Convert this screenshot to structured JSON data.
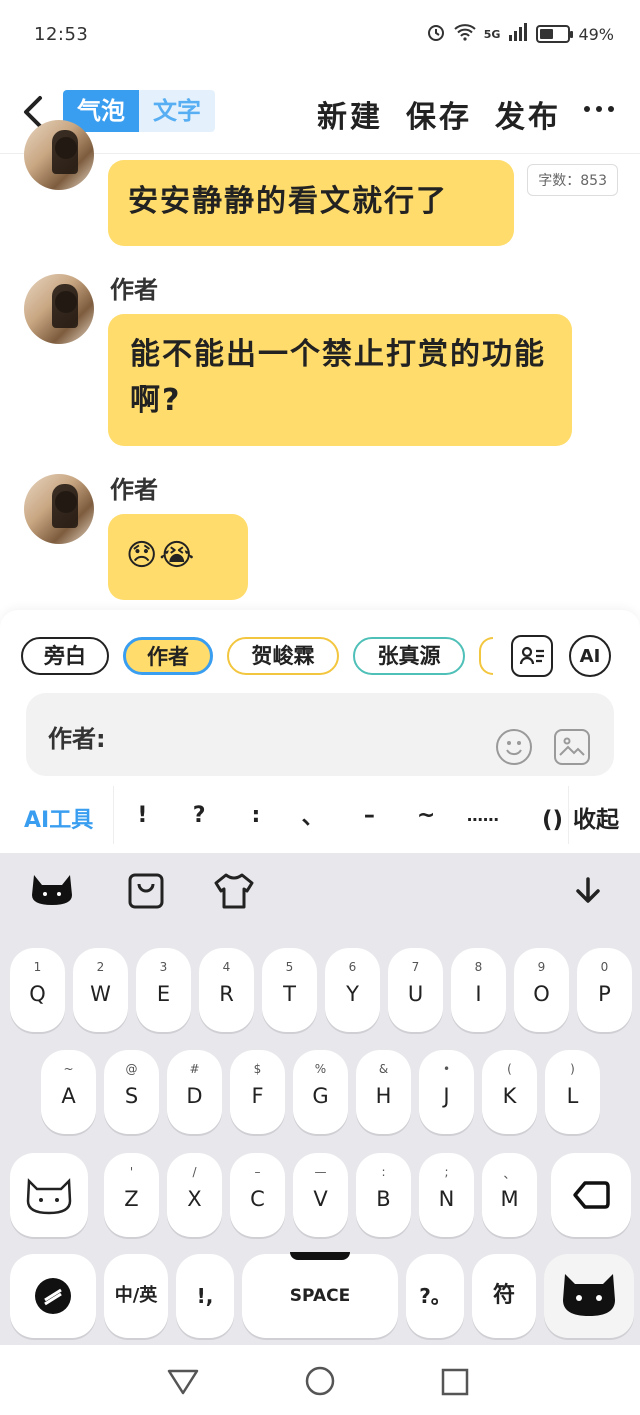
{
  "status": {
    "time": "12:53",
    "network": "5G",
    "battery": "49%",
    "battery_level": 0.49
  },
  "header": {
    "tab_bubble": "气泡",
    "tab_text": "文字",
    "new_label": "新建",
    "save_label": "保存",
    "publish_label": "发布"
  },
  "word_count": "字数：853",
  "messages": [
    {
      "speaker": "",
      "text": "安安静静的看文就行了"
    },
    {
      "speaker": "作者",
      "text": "能不能出一个禁止打赏的功能啊?"
    },
    {
      "speaker": "作者",
      "text": "😞😭"
    }
  ],
  "characters": [
    "旁白",
    "作者",
    "贺峻霖",
    "张真源"
  ],
  "ai_button": "AI",
  "input": {
    "label": "作者:"
  },
  "toolbar": {
    "ai_tool": "AI工具",
    "punctuation": [
      "!",
      "?",
      ":",
      "、",
      "–",
      "~",
      "……",
      "()"
    ],
    "collapse": "收起"
  },
  "keyboard": {
    "row1": [
      {
        "sub": "1",
        "key": "Q"
      },
      {
        "sub": "2",
        "key": "W"
      },
      {
        "sub": "3",
        "key": "E"
      },
      {
        "sub": "4",
        "key": "R"
      },
      {
        "sub": "5",
        "key": "T"
      },
      {
        "sub": "6",
        "key": "Y"
      },
      {
        "sub": "7",
        "key": "U"
      },
      {
        "sub": "8",
        "key": "I"
      },
      {
        "sub": "9",
        "key": "O"
      },
      {
        "sub": "0",
        "key": "P"
      }
    ],
    "row2": [
      {
        "sub": "~",
        "key": "A"
      },
      {
        "sub": "@",
        "key": "S"
      },
      {
        "sub": "#",
        "key": "D"
      },
      {
        "sub": "$",
        "key": "F"
      },
      {
        "sub": "%",
        "key": "G"
      },
      {
        "sub": "&",
        "key": "H"
      },
      {
        "sub": "•",
        "key": "J"
      },
      {
        "sub": "(",
        "key": "K"
      },
      {
        "sub": ")",
        "key": "L"
      }
    ],
    "row3": [
      {
        "sub": "'",
        "key": "Z"
      },
      {
        "sub": "/",
        "key": "X"
      },
      {
        "sub": "–",
        "key": "C"
      },
      {
        "sub": "—",
        "key": "V"
      },
      {
        "sub": ":",
        "key": "B"
      },
      {
        "sub": ";",
        "key": "N"
      },
      {
        "sub": "、",
        "key": "M"
      }
    ],
    "lang_key": "中/英",
    "comma_key": "!,",
    "space_key": "SPACE",
    "question_key": "?。",
    "symbol_key": "符"
  },
  "colors": {
    "accent": "#3a9ef0",
    "bubble": "#ffdc6b",
    "chip_narrator": "#222222",
    "chip_author": "#3a9ef0",
    "chip_he": "#f3c63f",
    "chip_zhang": "#4fc0b8"
  }
}
